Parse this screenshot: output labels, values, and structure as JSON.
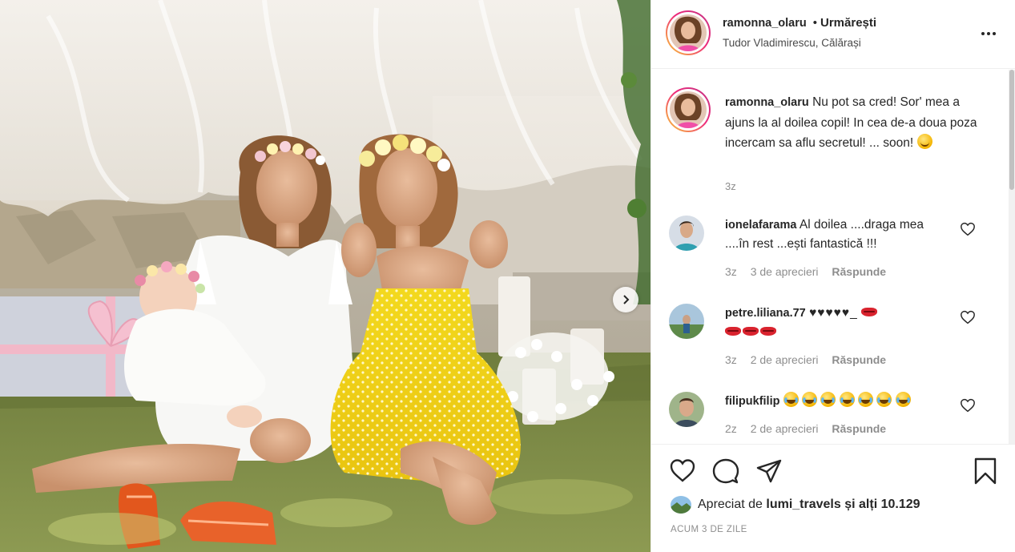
{
  "post": {
    "username": "ramonna_olaru",
    "follow_separator": "•",
    "follow_status": "Urmărești",
    "location": "Tudor Vladimirescu, Călărași",
    "caption_text": "Nu pot sa cred! Sor' mea a ajuns la al doilea copil! In cea de-a doua poza incercam sa aflu secretul! ... soon!",
    "caption_emoji": "grinning-face",
    "caption_time": "3z",
    "liked_by_label": "Apreciat de",
    "liked_by_user": "lumi_travels",
    "liked_by_rest": "și alți 10.129",
    "post_age": "ACUM 3 DE ZILE"
  },
  "comments": [
    {
      "username": "ionelafarama",
      "text": "Al doilea ....draga mea ....în rest ...ești fantastică !!!",
      "time": "3z",
      "likes": "3 de aprecieri",
      "reply": "Răspunde"
    },
    {
      "username": "petre.liliana.77",
      "text": "♥♥♥♥♥_",
      "emoji": "kiss-mark",
      "time": "3z",
      "likes": "2 de aprecieri",
      "reply": "Răspunde"
    },
    {
      "username": "filipukfilip",
      "text": "",
      "emoji": "tears-of-joy",
      "time": "2z",
      "likes": "2 de aprecieri",
      "reply": "Răspunde"
    }
  ],
  "icons": {
    "like": "heart-icon",
    "comment": "comment-bubble-icon",
    "share": "paper-plane-icon",
    "save": "bookmark-icon",
    "more": "more-options-icon",
    "carousel_next": "chevron-right-icon"
  },
  "colors": {
    "text": "#262626",
    "secondary": "#8e8e8e",
    "border": "#efefef",
    "story_ring_start": "#f9ce34",
    "story_ring_end": "#c13584"
  }
}
